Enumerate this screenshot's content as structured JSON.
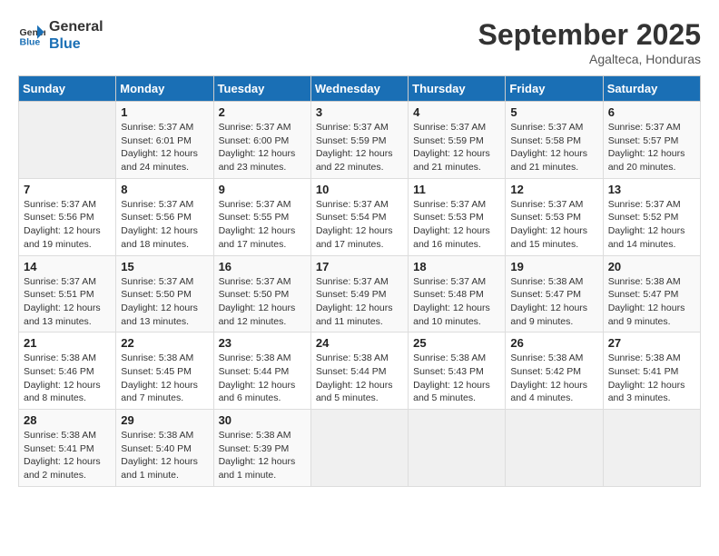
{
  "header": {
    "logo_line1": "General",
    "logo_line2": "Blue",
    "month_title": "September 2025",
    "subtitle": "Agalteca, Honduras"
  },
  "days_of_week": [
    "Sunday",
    "Monday",
    "Tuesday",
    "Wednesday",
    "Thursday",
    "Friday",
    "Saturday"
  ],
  "weeks": [
    [
      {
        "day": "",
        "info": ""
      },
      {
        "day": "1",
        "info": "Sunrise: 5:37 AM\nSunset: 6:01 PM\nDaylight: 12 hours\nand 24 minutes."
      },
      {
        "day": "2",
        "info": "Sunrise: 5:37 AM\nSunset: 6:00 PM\nDaylight: 12 hours\nand 23 minutes."
      },
      {
        "day": "3",
        "info": "Sunrise: 5:37 AM\nSunset: 5:59 PM\nDaylight: 12 hours\nand 22 minutes."
      },
      {
        "day": "4",
        "info": "Sunrise: 5:37 AM\nSunset: 5:59 PM\nDaylight: 12 hours\nand 21 minutes."
      },
      {
        "day": "5",
        "info": "Sunrise: 5:37 AM\nSunset: 5:58 PM\nDaylight: 12 hours\nand 21 minutes."
      },
      {
        "day": "6",
        "info": "Sunrise: 5:37 AM\nSunset: 5:57 PM\nDaylight: 12 hours\nand 20 minutes."
      }
    ],
    [
      {
        "day": "7",
        "info": "Sunrise: 5:37 AM\nSunset: 5:56 PM\nDaylight: 12 hours\nand 19 minutes."
      },
      {
        "day": "8",
        "info": "Sunrise: 5:37 AM\nSunset: 5:56 PM\nDaylight: 12 hours\nand 18 minutes."
      },
      {
        "day": "9",
        "info": "Sunrise: 5:37 AM\nSunset: 5:55 PM\nDaylight: 12 hours\nand 17 minutes."
      },
      {
        "day": "10",
        "info": "Sunrise: 5:37 AM\nSunset: 5:54 PM\nDaylight: 12 hours\nand 17 minutes."
      },
      {
        "day": "11",
        "info": "Sunrise: 5:37 AM\nSunset: 5:53 PM\nDaylight: 12 hours\nand 16 minutes."
      },
      {
        "day": "12",
        "info": "Sunrise: 5:37 AM\nSunset: 5:53 PM\nDaylight: 12 hours\nand 15 minutes."
      },
      {
        "day": "13",
        "info": "Sunrise: 5:37 AM\nSunset: 5:52 PM\nDaylight: 12 hours\nand 14 minutes."
      }
    ],
    [
      {
        "day": "14",
        "info": "Sunrise: 5:37 AM\nSunset: 5:51 PM\nDaylight: 12 hours\nand 13 minutes."
      },
      {
        "day": "15",
        "info": "Sunrise: 5:37 AM\nSunset: 5:50 PM\nDaylight: 12 hours\nand 13 minutes."
      },
      {
        "day": "16",
        "info": "Sunrise: 5:37 AM\nSunset: 5:50 PM\nDaylight: 12 hours\nand 12 minutes."
      },
      {
        "day": "17",
        "info": "Sunrise: 5:37 AM\nSunset: 5:49 PM\nDaylight: 12 hours\nand 11 minutes."
      },
      {
        "day": "18",
        "info": "Sunrise: 5:37 AM\nSunset: 5:48 PM\nDaylight: 12 hours\nand 10 minutes."
      },
      {
        "day": "19",
        "info": "Sunrise: 5:38 AM\nSunset: 5:47 PM\nDaylight: 12 hours\nand 9 minutes."
      },
      {
        "day": "20",
        "info": "Sunrise: 5:38 AM\nSunset: 5:47 PM\nDaylight: 12 hours\nand 9 minutes."
      }
    ],
    [
      {
        "day": "21",
        "info": "Sunrise: 5:38 AM\nSunset: 5:46 PM\nDaylight: 12 hours\nand 8 minutes."
      },
      {
        "day": "22",
        "info": "Sunrise: 5:38 AM\nSunset: 5:45 PM\nDaylight: 12 hours\nand 7 minutes."
      },
      {
        "day": "23",
        "info": "Sunrise: 5:38 AM\nSunset: 5:44 PM\nDaylight: 12 hours\nand 6 minutes."
      },
      {
        "day": "24",
        "info": "Sunrise: 5:38 AM\nSunset: 5:44 PM\nDaylight: 12 hours\nand 5 minutes."
      },
      {
        "day": "25",
        "info": "Sunrise: 5:38 AM\nSunset: 5:43 PM\nDaylight: 12 hours\nand 5 minutes."
      },
      {
        "day": "26",
        "info": "Sunrise: 5:38 AM\nSunset: 5:42 PM\nDaylight: 12 hours\nand 4 minutes."
      },
      {
        "day": "27",
        "info": "Sunrise: 5:38 AM\nSunset: 5:41 PM\nDaylight: 12 hours\nand 3 minutes."
      }
    ],
    [
      {
        "day": "28",
        "info": "Sunrise: 5:38 AM\nSunset: 5:41 PM\nDaylight: 12 hours\nand 2 minutes."
      },
      {
        "day": "29",
        "info": "Sunrise: 5:38 AM\nSunset: 5:40 PM\nDaylight: 12 hours\nand 1 minute."
      },
      {
        "day": "30",
        "info": "Sunrise: 5:38 AM\nSunset: 5:39 PM\nDaylight: 12 hours\nand 1 minute."
      },
      {
        "day": "",
        "info": ""
      },
      {
        "day": "",
        "info": ""
      },
      {
        "day": "",
        "info": ""
      },
      {
        "day": "",
        "info": ""
      }
    ]
  ]
}
